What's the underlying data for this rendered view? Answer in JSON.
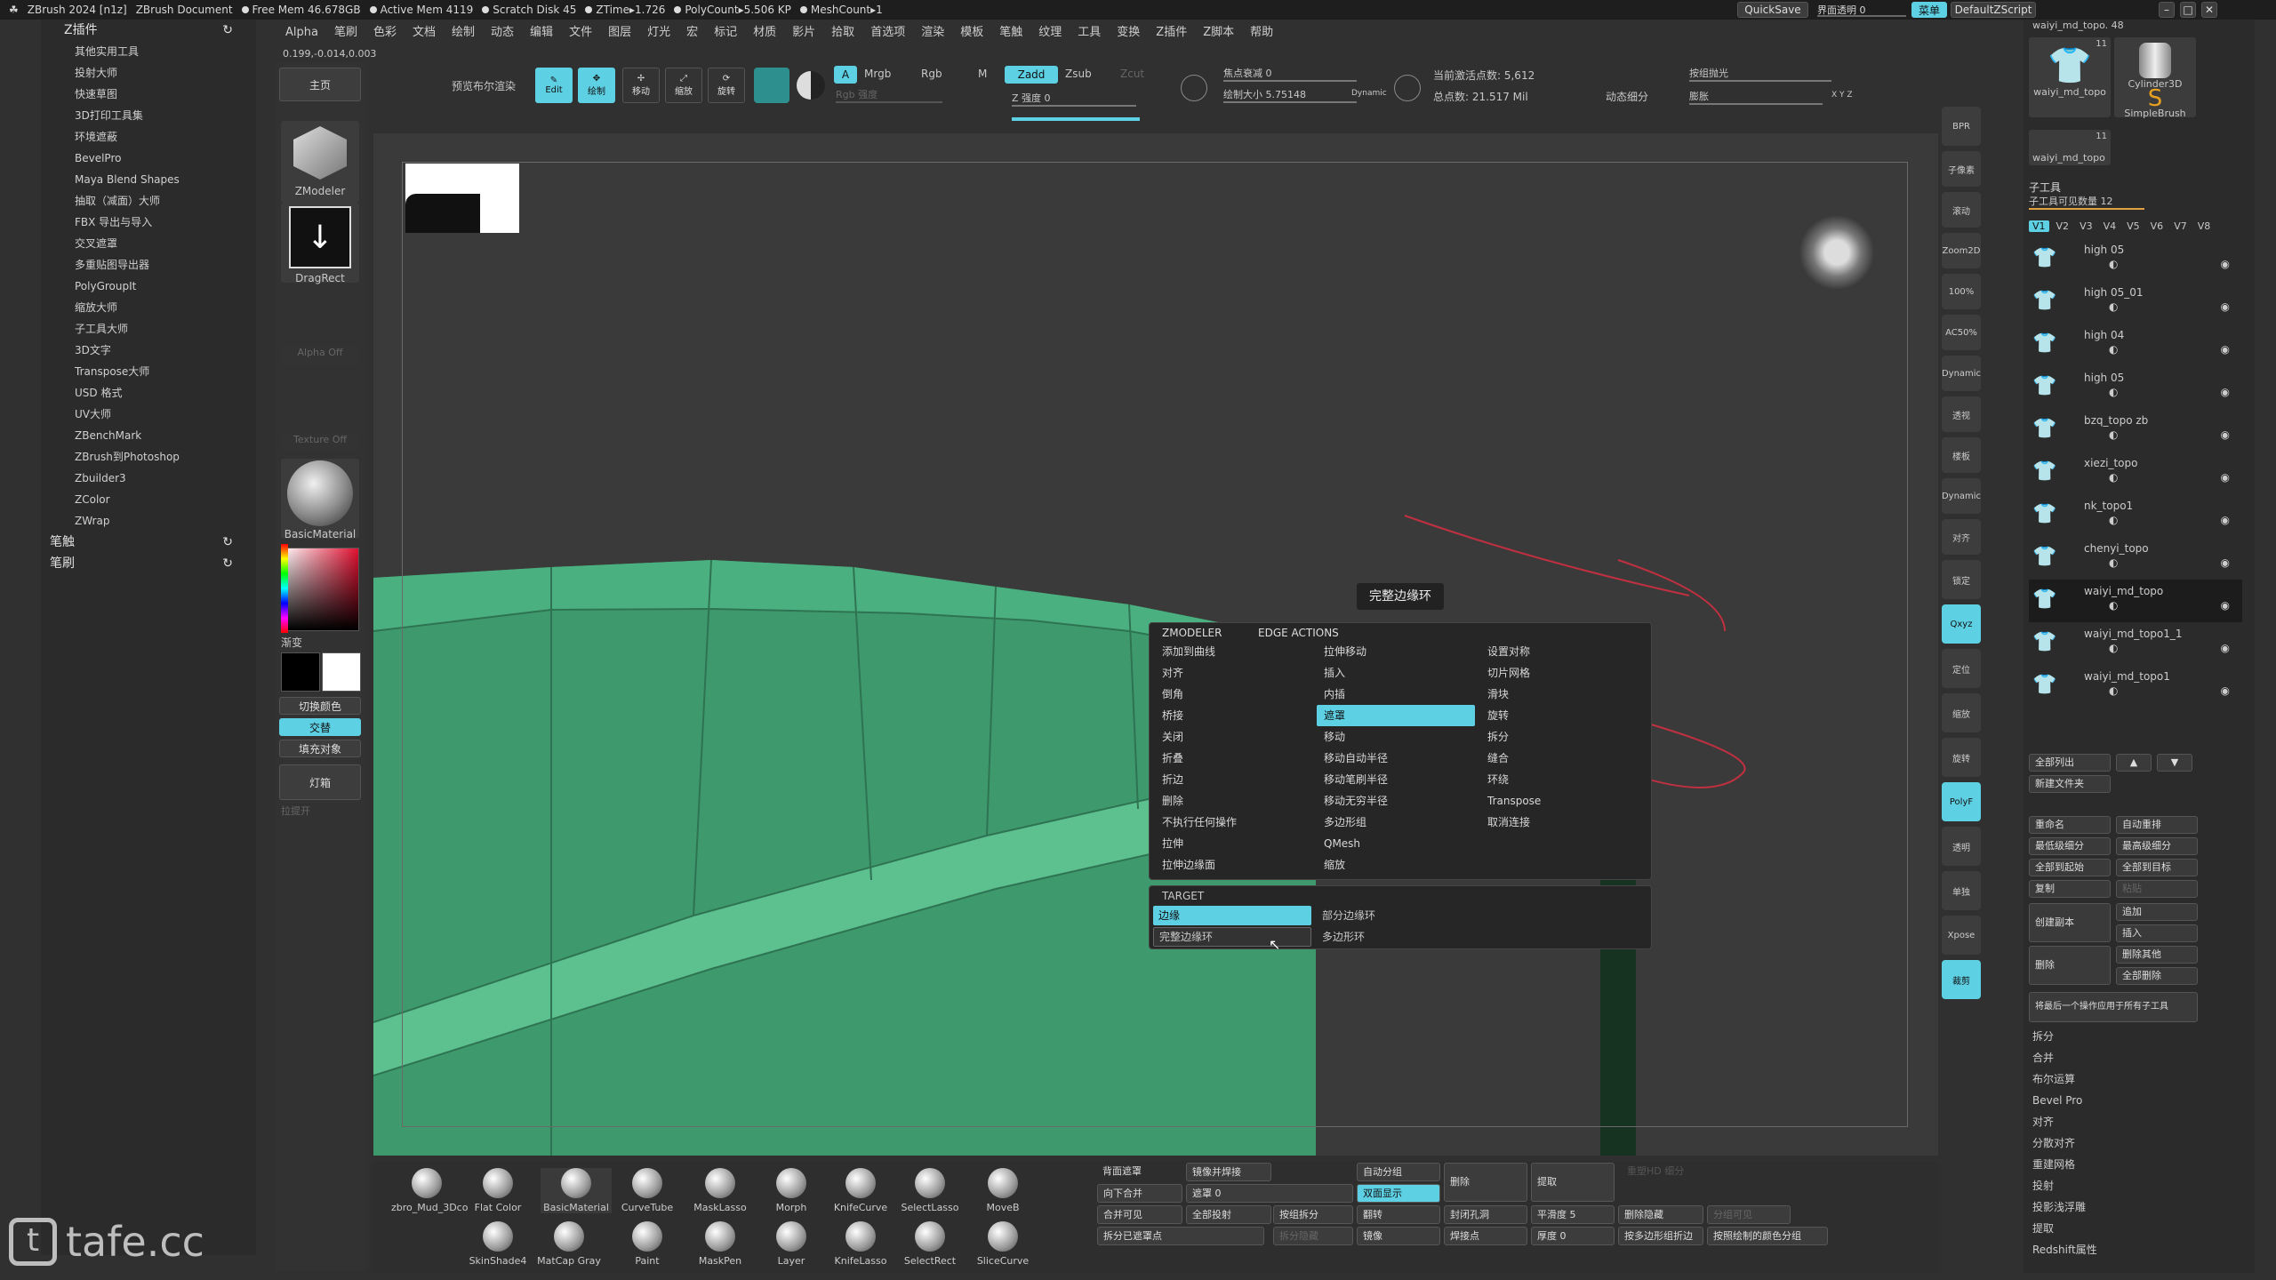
{
  "system_bar": {
    "app": "ZBrush 2024 [n1z]",
    "document": "ZBrush Document",
    "free_mem": "Free Mem 46.678GB",
    "active_mem": "Active Mem 4119",
    "scratch_disk": "Scratch Disk 45",
    "ztime": "ZTime▸1.726",
    "polycount": "PolyCount▸5.506 KP",
    "meshcount": "MeshCount▸1",
    "quicksave": "QuickSave",
    "interface_transparency": "界面透明 0",
    "menu_label": "菜单",
    "default_script": "DefaultZScript"
  },
  "menu": [
    "Alpha",
    "笔刷",
    "色彩",
    "文档",
    "绘制",
    "动态",
    "编辑",
    "文件",
    "图层",
    "灯光",
    "宏",
    "标记",
    "材质",
    "影片",
    "拾取",
    "首选项",
    "渲染",
    "模板",
    "笔触",
    "纹理",
    "工具",
    "变换",
    "Z插件",
    "Z脚本",
    "帮助"
  ],
  "coords": "0.199,-0.014,0.003",
  "left_panel": {
    "header": "Z插件",
    "items": [
      "其他实用工具",
      "投射大师",
      "快速草图",
      "3D打印工具集",
      "环境遮蔽",
      "BevelPro",
      "Maya Blend Shapes",
      "抽取（减面）大师",
      "FBX 导出与导入",
      "交叉遮罩",
      "多重贴图导出器",
      "PolyGroupIt",
      "缩放大师",
      "子工具大师",
      "3D文字",
      "Transpose大师",
      "USD 格式",
      "UV大师",
      "ZBenchMark",
      "ZBrush到Photoshop",
      "Zbuilder3",
      "ZColor",
      "ZWrap"
    ],
    "footer1": "笔触",
    "footer2": "笔刷"
  },
  "tool_column": {
    "home": "主页",
    "zmodeler": "ZModeler",
    "dragrect": "DragRect",
    "alpha_off": "Alpha Off",
    "texture_off": "Texture Off",
    "material": "BasicMaterial",
    "gradient": "渐变",
    "switch_color": "切换颜色",
    "swap": "交替",
    "fill": "填充对象",
    "light": "灯箱",
    "extra": "拉提开"
  },
  "top_controls": {
    "preview": "预览布尔渲染",
    "edit": "Edit",
    "draw": "绘制",
    "move": "移动",
    "scale": "缩放",
    "rotate": "旋转",
    "a": "A",
    "mrgb": "Mrgb",
    "rgb": "Rgb",
    "m": "M",
    "zadd": "Zadd",
    "zsub": "Zsub",
    "zcut": "Zcut",
    "rgb_strength": "Rgb 强度",
    "z_strength": "Z 强度 0",
    "focal": "焦点衰减 0",
    "draw_size": "绘制大小 5.75148",
    "dynamic": "Dynamic",
    "active_points": "当前激活点数: 5,612",
    "total_points": "总点数: 21.517 Mil",
    "dynamic_subdiv": "动态细分",
    "lightcap": "按组抛光",
    "inflate": "膨胀",
    "xyz": "X Y Z"
  },
  "right_buttons": [
    "BPR",
    "子像素",
    "滚动",
    "Zoom2D",
    "100%",
    "AC50%",
    "Dynamic",
    "透视",
    "楼板",
    "Dynamic",
    "对齐",
    "锁定",
    "Qxyz",
    "定位",
    "缩放",
    "旋转",
    "PolyF",
    "透明",
    "单独",
    "Xpose",
    "裁剪"
  ],
  "subtool": {
    "top_label": "waiyi_md_topo. 48",
    "thumb1": "waiyi_md_topo",
    "thumb2": "Cylinder3D",
    "thumb3": "SimpleBrush",
    "thumb4": "waiyi_md_topo",
    "n1": "11",
    "n2": "11",
    "header": "子工具",
    "visible_count": "子工具可见数量 12",
    "versions": [
      "V1",
      "V2",
      "V3",
      "V4",
      "V5",
      "V6",
      "V7",
      "V8"
    ],
    "items": [
      "high 05",
      "high 05_01",
      "high 04",
      "high 05",
      "bzq_topo zb",
      "xiezi_topo",
      "nk_topo1",
      "chenyi_topo",
      "waiyi_md_topo",
      "waiyi_md_topo1_1",
      "waiyi_md_topo1"
    ],
    "btn_list_all": "全部列出",
    "btn_new_folder": "新建文件夹",
    "btn_rename": "重命名",
    "btn_autosort": "自动重排",
    "btn_lowest": "最低级细分",
    "btn_highest": "最高级细分",
    "btn_all_start": "全部到起始",
    "btn_all_target": "全部到目标",
    "btn_copy": "复制",
    "btn_paste": "粘贴",
    "btn_create_copy": "创建副本",
    "btn_append": "追加",
    "btn_insert": "插入",
    "btn_delete": "删除",
    "btn_delete_other": "删除其他",
    "btn_delete_all": "全部删除",
    "btn_apply_last": "将最后一个操作应用于所有子工具",
    "sections": [
      "拆分",
      "合并",
      "布尔运算",
      "Bevel Pro",
      "对齐",
      "分散对齐",
      "重建网格",
      "投射",
      "投影浅浮雕",
      "提取",
      "Redshift属性"
    ]
  },
  "popup": {
    "title1": "ZMODELER",
    "title2": "EDGE ACTIONS",
    "col1": [
      "添加到曲线",
      "对齐",
      "倒角",
      "桥接",
      "关闭",
      "折叠",
      "折边",
      "删除",
      "不执行任何操作",
      "拉伸",
      "拉伸边缘面"
    ],
    "col2": [
      "拉伸移动",
      "插入",
      "内插",
      "遮罩",
      "移动",
      "移动自动半径",
      "移动笔刷半径",
      "移动无穷半径",
      "多边形组",
      "QMesh",
      "缩放"
    ],
    "col3": [
      "设置对称",
      "切片网格",
      "滑块",
      "旋转",
      "拆分",
      "缝合",
      "环绕",
      "Transpose",
      "取消连接"
    ],
    "selected": "遮罩",
    "target_title": "TARGET",
    "target1": "边缘",
    "target2": "部分边缘环",
    "target3": "完整边缘环",
    "target4": "多边形环",
    "tooltip": "完整边缘环"
  },
  "bottom": {
    "brushes": [
      "zbro_Mud_3Dco",
      "Flat Color",
      "BasicMaterial",
      "CurveTube",
      "MaskLasso",
      "Morph",
      "KnifeCurve",
      "SelectLasso",
      "MoveB",
      "SkinShade4",
      "MatCap Gray",
      "Paint",
      "MaskPen",
      "Layer",
      "KnifeLasso",
      "SelectRect",
      "SliceCurve"
    ],
    "grid": {
      "r1": [
        "背面遮罩",
        "镜像并焊接",
        "自动分组",
        "删除",
        "提取"
      ],
      "r2": [
        "向下合并",
        "遮罩 0",
        "镜像",
        "双面显示"
      ],
      "r3": [
        "合并可见",
        "全部投射",
        "按组拆分",
        "翻转",
        "封闭孔洞",
        "平滑度 5",
        "删除隐藏",
        "分组可见"
      ],
      "r4": [
        "拆分已遮罩点",
        "拆分隐藏",
        "镜像",
        "焊接点",
        "厚度 0",
        "按多边形组折边",
        "按照绘制的颜色分组"
      ],
      "extra": "重塑HD 细分"
    }
  },
  "watermark": "tafe.cc",
  "colors": {
    "accent": "#5ed0e4",
    "mesh": "#3d9a6c",
    "background": "#3a3a3a"
  }
}
